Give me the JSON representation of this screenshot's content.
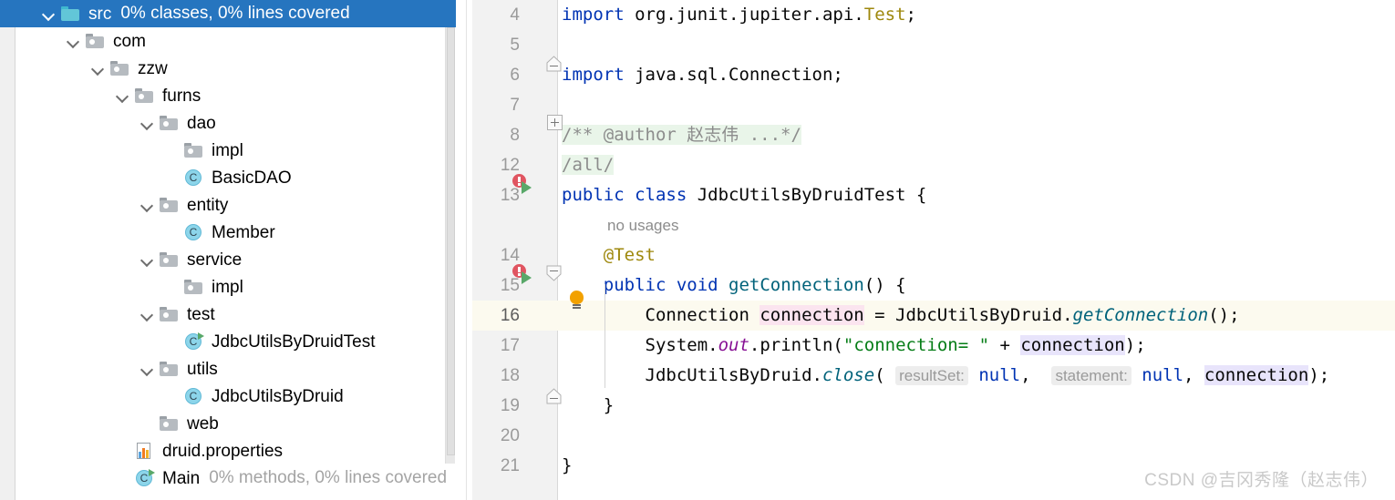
{
  "project_tree": {
    "selected_index": 0,
    "rows": [
      {
        "depth": 1,
        "chevron": "down",
        "icon": "source-folder-icon",
        "label": "src",
        "coverage": "0% classes, 0% lines covered",
        "selected": true
      },
      {
        "depth": 2,
        "chevron": "down",
        "icon": "folder-icon",
        "label": "com",
        "coverage": ""
      },
      {
        "depth": 3,
        "chevron": "down",
        "icon": "folder-icon",
        "label": "zzw",
        "coverage": ""
      },
      {
        "depth": 4,
        "chevron": "down",
        "icon": "folder-icon",
        "label": "furns",
        "coverage": ""
      },
      {
        "depth": 5,
        "chevron": "down",
        "icon": "folder-icon",
        "label": "dao",
        "coverage": ""
      },
      {
        "depth": 6,
        "chevron": "none",
        "icon": "folder-icon",
        "label": "impl",
        "coverage": ""
      },
      {
        "depth": 6,
        "chevron": "none",
        "icon": "class-icon",
        "label": "BasicDAO",
        "coverage": ""
      },
      {
        "depth": 5,
        "chevron": "down",
        "icon": "folder-icon",
        "label": "entity",
        "coverage": ""
      },
      {
        "depth": 6,
        "chevron": "none",
        "icon": "class-icon",
        "label": "Member",
        "coverage": ""
      },
      {
        "depth": 5,
        "chevron": "down",
        "icon": "folder-icon",
        "label": "service",
        "coverage": ""
      },
      {
        "depth": 6,
        "chevron": "none",
        "icon": "folder-icon",
        "label": "impl",
        "coverage": ""
      },
      {
        "depth": 5,
        "chevron": "down",
        "icon": "folder-icon",
        "label": "test",
        "coverage": ""
      },
      {
        "depth": 6,
        "chevron": "none",
        "icon": "runnable-class-icon",
        "label": "JdbcUtilsByDruidTest",
        "coverage": ""
      },
      {
        "depth": 5,
        "chevron": "down",
        "icon": "folder-icon",
        "label": "utils",
        "coverage": ""
      },
      {
        "depth": 6,
        "chevron": "none",
        "icon": "class-icon",
        "label": "JdbcUtilsByDruid",
        "coverage": ""
      },
      {
        "depth": 5,
        "chevron": "none",
        "icon": "folder-icon",
        "label": "web",
        "coverage": ""
      },
      {
        "depth": 4,
        "chevron": "none",
        "icon": "properties-file-icon",
        "label": "druid.properties",
        "coverage": ""
      },
      {
        "depth": 4,
        "chevron": "none",
        "icon": "runnable-class-icon",
        "label": "Main",
        "coverage": "0% methods, 0% lines covered"
      }
    ]
  },
  "editor": {
    "lines": [
      {
        "number": "4",
        "tokens": [
          {
            "text": "import ",
            "style": "kw"
          },
          {
            "text": "org.junit.jupiter.api.",
            "style": "cls"
          },
          {
            "text": "Test",
            "style": "anno"
          },
          {
            "text": ";",
            "style": "cls"
          }
        ]
      },
      {
        "number": "5",
        "tokens": []
      },
      {
        "number": "6",
        "tokens": [
          {
            "text": "import ",
            "style": "kw"
          },
          {
            "text": "java.sql.Connection;",
            "style": "cls"
          }
        ]
      },
      {
        "number": "7",
        "tokens": []
      },
      {
        "number": "8",
        "fold_comment": true,
        "tokens": [
          {
            "text": "/** @author ",
            "style": "cmt"
          },
          {
            "text": "赵志伟",
            "style": "cmt"
          },
          {
            "text": " ...*/",
            "style": "cmt"
          }
        ]
      },
      {
        "number": "12",
        "fold_comment": true,
        "tokens": [
          {
            "text": "/all/",
            "style": "cmt"
          }
        ]
      },
      {
        "number": "13",
        "tokens": [
          {
            "text": "public ",
            "style": "kw"
          },
          {
            "text": "class ",
            "style": "kw"
          },
          {
            "text": "JdbcUtilsByDruidTest {",
            "style": "cls"
          }
        ]
      },
      {
        "number": "",
        "inlay": "no usages"
      },
      {
        "number": "14",
        "tokens": [
          {
            "text": "    @Test",
            "style": "anno"
          }
        ]
      },
      {
        "number": "15",
        "tokens": [
          {
            "text": "    public ",
            "style": "kw"
          },
          {
            "text": "void ",
            "style": "kw"
          },
          {
            "text": "getConnection",
            "style": "methn"
          },
          {
            "text": "() {",
            "style": "cls"
          }
        ]
      },
      {
        "number": "16",
        "current": true,
        "tokens": [
          {
            "text": "        Connection ",
            "style": "cls"
          },
          {
            "text": "connection",
            "style": "cls",
            "highlight": "write"
          },
          {
            "text": " = JdbcUtilsByDruid.",
            "style": "cls"
          },
          {
            "text": "getConnection",
            "style": "meth"
          },
          {
            "text": "();",
            "style": "cls"
          }
        ]
      },
      {
        "number": "17",
        "tokens": [
          {
            "text": "        System.",
            "style": "cls"
          },
          {
            "text": "out",
            "style": "stat"
          },
          {
            "text": ".println(",
            "style": "cls"
          },
          {
            "text": "\"connection= \"",
            "style": "str"
          },
          {
            "text": " + ",
            "style": "cls"
          },
          {
            "text": "connection",
            "style": "cls",
            "highlight": "read"
          },
          {
            "text": ");",
            "style": "cls"
          }
        ]
      },
      {
        "number": "18",
        "tokens": [
          {
            "text": "        JdbcUtilsByDruid.",
            "style": "cls"
          },
          {
            "text": "close",
            "style": "meth"
          },
          {
            "text": "( ",
            "style": "cls"
          },
          {
            "text": "resultSet:",
            "style": "hint"
          },
          {
            "text": " ",
            "style": "cls"
          },
          {
            "text": "null",
            "style": "kw"
          },
          {
            "text": ",  ",
            "style": "cls"
          },
          {
            "text": "statement:",
            "style": "hint"
          },
          {
            "text": " ",
            "style": "cls"
          },
          {
            "text": "null",
            "style": "kw"
          },
          {
            "text": ", ",
            "style": "cls"
          },
          {
            "text": "connection",
            "style": "cls",
            "highlight": "read"
          },
          {
            "text": ");",
            "style": "cls"
          }
        ]
      },
      {
        "number": "19",
        "tokens": [
          {
            "text": "    }",
            "style": "cls"
          }
        ]
      },
      {
        "number": "20",
        "tokens": []
      },
      {
        "number": "21",
        "tokens": [
          {
            "text": "}",
            "style": "cls"
          }
        ]
      }
    ]
  },
  "watermark": {
    "text": "CSDN @吉冈秀隆（赵志伟）"
  },
  "colors": {
    "selection_blue": "#2675bf",
    "keyword_blue": "#0033b3",
    "string_green": "#067d17",
    "method_teal": "#00627a",
    "static_purple": "#871094",
    "annotation_gold": "#9e880d",
    "comment_gray": "#8c8c8c",
    "fold_comment_bg": "#e9f5e9",
    "current_line_bg": "#fcfaef",
    "write_highlight": "#fbe4ef",
    "read_highlight": "#e8e4fb",
    "run_green": "#59a869",
    "error_red": "#e05561",
    "bulb_orange": "#f2a100"
  }
}
